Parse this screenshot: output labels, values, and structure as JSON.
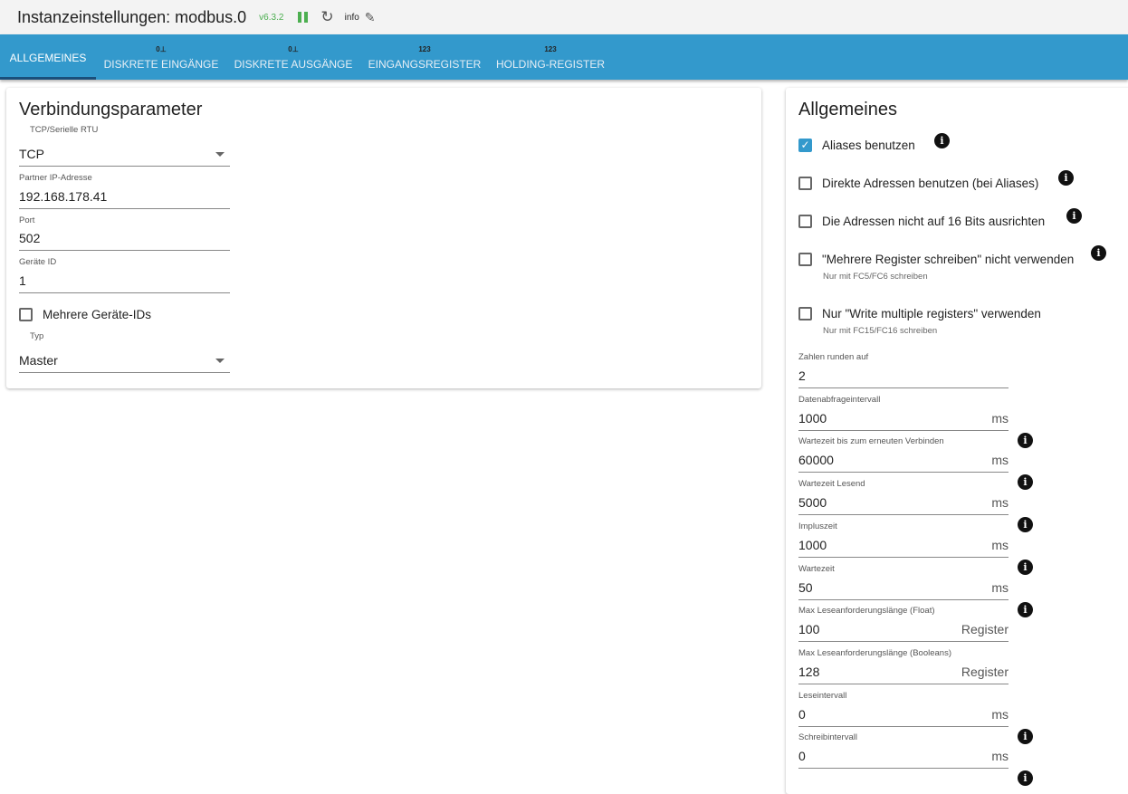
{
  "header": {
    "title": "Instanzeinstellungen: modbus.0",
    "version": "v6.3.2",
    "info": "info"
  },
  "tabs": [
    {
      "label": "ALLGEMEINES",
      "icon": ""
    },
    {
      "label": "DISKRETE EINGÄNGE",
      "icon": "0⊥"
    },
    {
      "label": "DISKRETE AUSGÄNGE",
      "icon": "0⊥"
    },
    {
      "label": "EINGANGSREGISTER",
      "icon": "123"
    },
    {
      "label": "HOLDING-REGISTER",
      "icon": "123"
    }
  ],
  "left": {
    "title": "Verbindungsparameter",
    "mode": {
      "label": "TCP/Serielle RTU",
      "value": "TCP"
    },
    "ip": {
      "label": "Partner IP-Adresse",
      "value": "192.168.178.41"
    },
    "port": {
      "label": "Port",
      "value": "502"
    },
    "device": {
      "label": "Geräte ID",
      "value": "1"
    },
    "multi": {
      "label": "Mehrere Geräte-IDs",
      "checked": false
    },
    "type": {
      "label": "Typ",
      "value": "Master"
    }
  },
  "right": {
    "title": "Allgemeines",
    "checks": [
      {
        "label": "Aliases benutzen",
        "checked": true,
        "sub": ""
      },
      {
        "label": "Direkte Adressen benutzen (bei Aliases)",
        "checked": false,
        "sub": ""
      },
      {
        "label": "Die Adressen nicht auf 16 Bits ausrichten",
        "checked": false,
        "sub": ""
      },
      {
        "label": "\"Mehrere Register schreiben\" nicht verwenden",
        "checked": false,
        "sub": "Nur mit FC5/FC6 schreiben"
      },
      {
        "label": "Nur \"Write multiple registers\" verwenden",
        "checked": false,
        "sub": "Nur mit FC15/FC16 schreiben"
      }
    ],
    "fields": [
      {
        "label": "Zahlen runden auf",
        "value": "2",
        "unit": "",
        "info": false
      },
      {
        "label": "Datenabfrageintervall",
        "value": "1000",
        "unit": "ms",
        "info": true
      },
      {
        "label": "Wartezeit bis zum erneuten Verbinden",
        "value": "60000",
        "unit": "ms",
        "info": true
      },
      {
        "label": "Wartezeit Lesend",
        "value": "5000",
        "unit": "ms",
        "info": true
      },
      {
        "label": "Impluszeit",
        "value": "1000",
        "unit": "ms",
        "info": true
      },
      {
        "label": "Wartezeit",
        "value": "50",
        "unit": "ms",
        "info": true
      },
      {
        "label": "Max Leseanforderungslänge (Float)",
        "value": "100",
        "unit": "Register",
        "info": false
      },
      {
        "label": "Max Leseanforderungslänge (Booleans)",
        "value": "128",
        "unit": "Register",
        "info": false
      },
      {
        "label": "Leseintervall",
        "value": "0",
        "unit": "ms",
        "info": true
      },
      {
        "label": "Schreibintervall",
        "value": "0",
        "unit": "ms",
        "info": true
      }
    ]
  }
}
